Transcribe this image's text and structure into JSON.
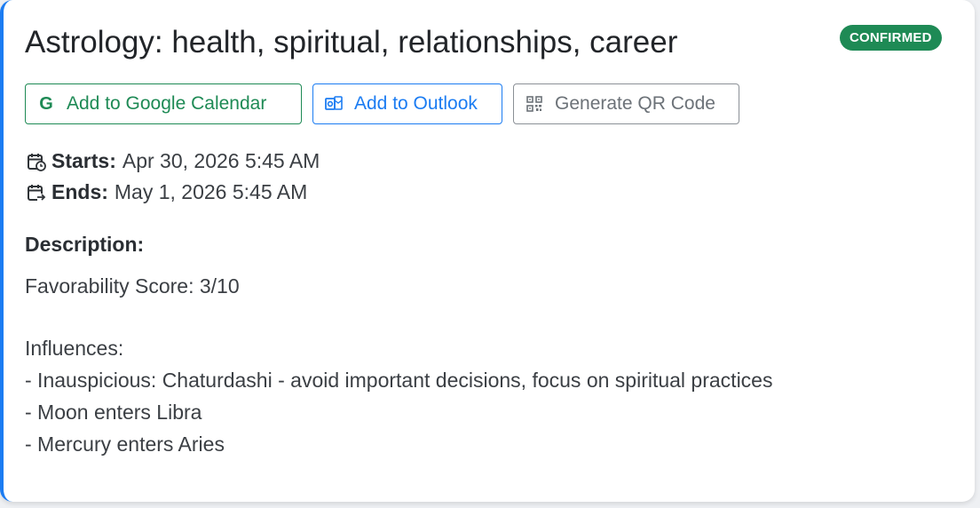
{
  "event": {
    "title": "Astrology: health, spiritual, relationships, career",
    "status": "CONFIRMED",
    "accent_color": "#1b7cf2",
    "status_color": "#1e8a55"
  },
  "actions": {
    "google_label": "Add to Google Calendar",
    "outlook_label": "Add to Outlook",
    "qr_label": "Generate QR Code"
  },
  "times": {
    "start_label": "Starts:",
    "start_value": "Apr 30, 2026 5:45 AM",
    "end_label": "Ends:",
    "end_value": "May 1, 2026 5:45 AM"
  },
  "description": {
    "heading": "Description:",
    "score": "Favorability Score: 3/10",
    "influences_heading": "Influences:",
    "influences": [
      "- Inauspicious: Chaturdashi - avoid important decisions, focus on spiritual practices",
      "- Moon enters Libra",
      "- Mercury enters Aries"
    ]
  },
  "icons": {
    "google": "google-g-icon",
    "outlook": "outlook-icon",
    "qr": "qr-code-icon",
    "start": "calendar-clock-icon",
    "end": "calendar-arrow-icon"
  }
}
